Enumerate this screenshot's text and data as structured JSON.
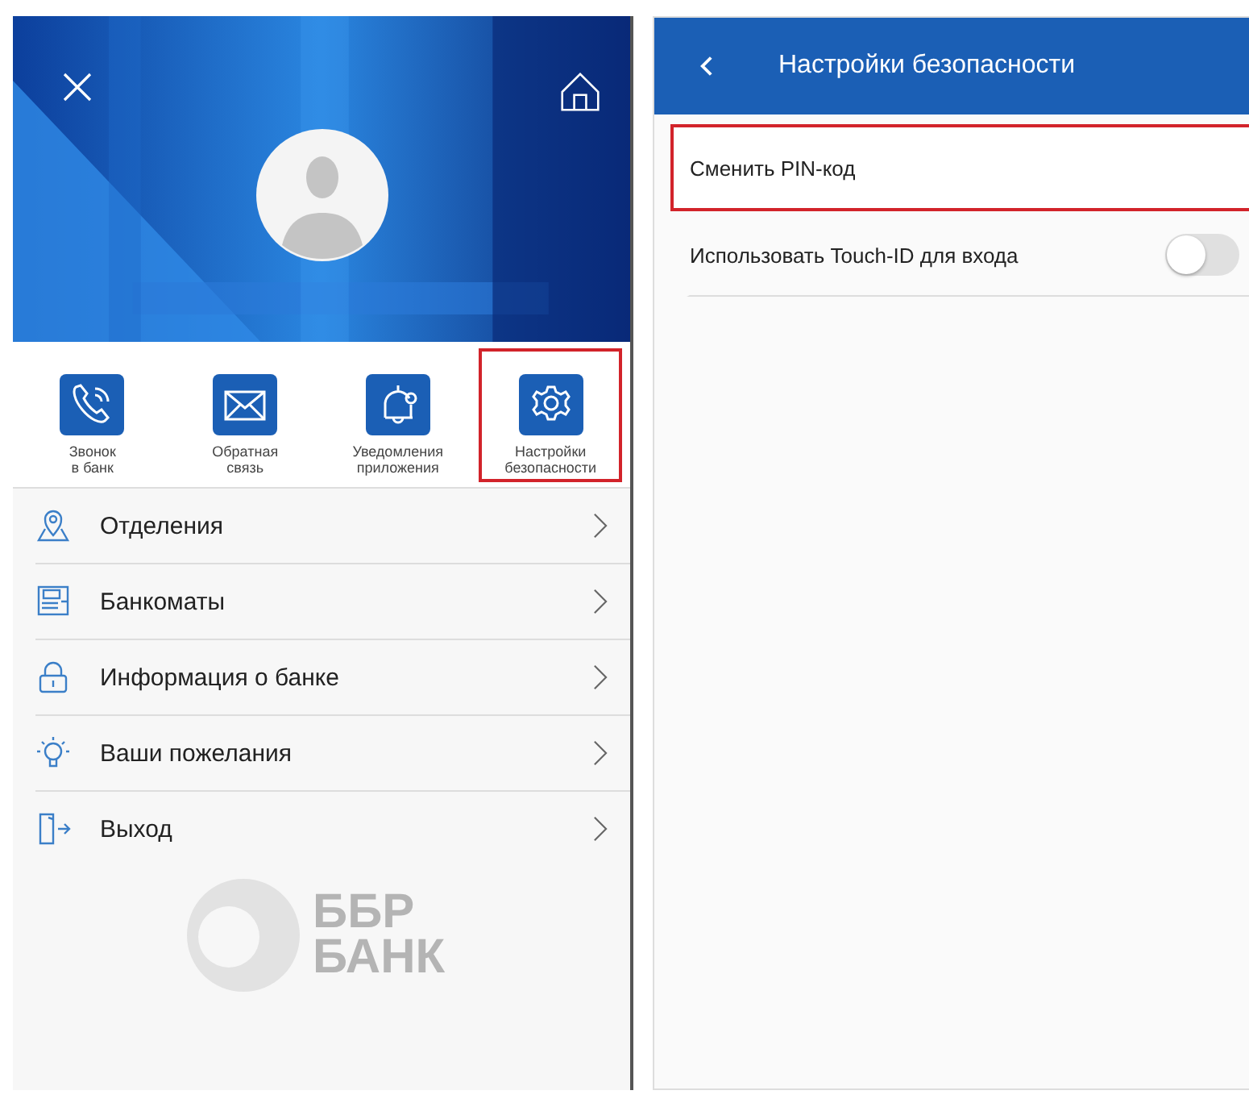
{
  "menu_screen": {
    "quick_actions": [
      {
        "label": "Звонок\nв банк",
        "kind": "phone",
        "highlighted": false
      },
      {
        "label": "Обратная\nсвязь",
        "kind": "envelope",
        "highlighted": false
      },
      {
        "label": "Уведомления\nприложения",
        "kind": "bell",
        "highlighted": false
      },
      {
        "label": "Настройки\nбезопасности",
        "kind": "gear",
        "highlighted": true
      }
    ],
    "menu_items": [
      {
        "label": "Отделения",
        "kind": "pin"
      },
      {
        "label": "Банкоматы",
        "kind": "atm"
      },
      {
        "label": "Информация о банке",
        "kind": "lock"
      },
      {
        "label": "Ваши пожелания",
        "kind": "bulb"
      },
      {
        "label": "Выход",
        "kind": "exit"
      }
    ],
    "logo": {
      "line_1": "ББР",
      "line_2": "БАНК"
    }
  },
  "security_screen": {
    "title": "Настройки безопасности",
    "items": [
      {
        "kind": "link",
        "label": "Сменить PIN-код",
        "highlighted": true
      },
      {
        "kind": "toggle",
        "label": "Использовать Touch-ID для входа",
        "on": false,
        "highlighted": false
      }
    ]
  }
}
